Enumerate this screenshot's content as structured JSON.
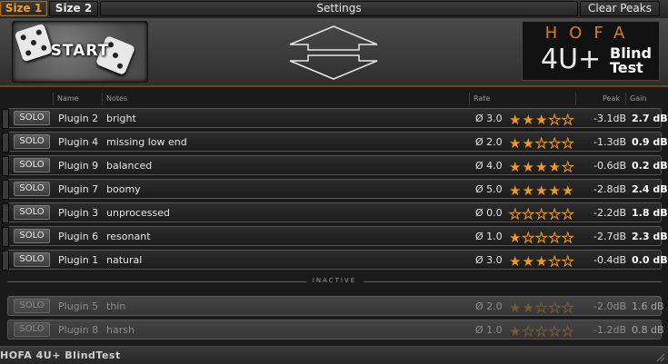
{
  "topbar": {
    "size1_label": "Size 1",
    "size2_label": "Size 2",
    "title": "Settings",
    "clear_peaks_label": "Clear Peaks"
  },
  "header": {
    "start_label": "START",
    "logo": {
      "brand": "HOFA",
      "version": "4U+",
      "product_line1": "Blind",
      "product_line2": "Test"
    }
  },
  "columns": {
    "name": "Name",
    "notes": "Notes",
    "rate": "Rate",
    "peak": "Peak",
    "gain": "Gain"
  },
  "accent_color": "#f09a1c",
  "active_rows": [
    {
      "solo": "SOLO",
      "name": "Plugin 2",
      "notes": "bright",
      "avg": "Ø 3.0",
      "rating": 3,
      "peak": "-3.1dB",
      "gain": "2.7 dB"
    },
    {
      "solo": "SOLO",
      "name": "Plugin 4",
      "notes": "missing low end",
      "avg": "Ø 2.0",
      "rating": 2,
      "peak": "-1.3dB",
      "gain": "0.9 dB"
    },
    {
      "solo": "SOLO",
      "name": "Plugin 9",
      "notes": "balanced",
      "avg": "Ø 4.0",
      "rating": 4,
      "peak": "-0.6dB",
      "gain": "0.2 dB"
    },
    {
      "solo": "SOLO",
      "name": "Plugin 7",
      "notes": "boomy",
      "avg": "Ø 5.0",
      "rating": 5,
      "peak": "-2.8dB",
      "gain": "2.4 dB"
    },
    {
      "solo": "SOLO",
      "name": "Plugin 3",
      "notes": "unprocessed",
      "avg": "Ø 0.0",
      "rating": 0,
      "peak": "-2.2dB",
      "gain": "1.8 dB"
    },
    {
      "solo": "SOLO",
      "name": "Plugin 6",
      "notes": "resonant",
      "avg": "Ø 1.0",
      "rating": 1,
      "peak": "-2.7dB",
      "gain": "2.3 dB"
    },
    {
      "solo": "SOLO",
      "name": "Plugin 1",
      "notes": "natural",
      "avg": "Ø 3.0",
      "rating": 3,
      "peak": "-0.4dB",
      "gain": "0.0 dB"
    }
  ],
  "inactive_label": "INACTIVE",
  "inactive_rows": [
    {
      "solo": "SOLO",
      "name": "Plugin 5",
      "notes": "thin",
      "avg": "Ø 2.0",
      "rating": 2,
      "peak": "-2.0dB",
      "gain": "1.6 dB"
    },
    {
      "solo": "SOLO",
      "name": "Plugin 8",
      "notes": "harsh",
      "avg": "Ø 1.0",
      "rating": 1,
      "peak": "-1.2dB",
      "gain": "0.8 dB"
    }
  ],
  "footer": {
    "title": "HOFA 4U+ BlindTest"
  }
}
